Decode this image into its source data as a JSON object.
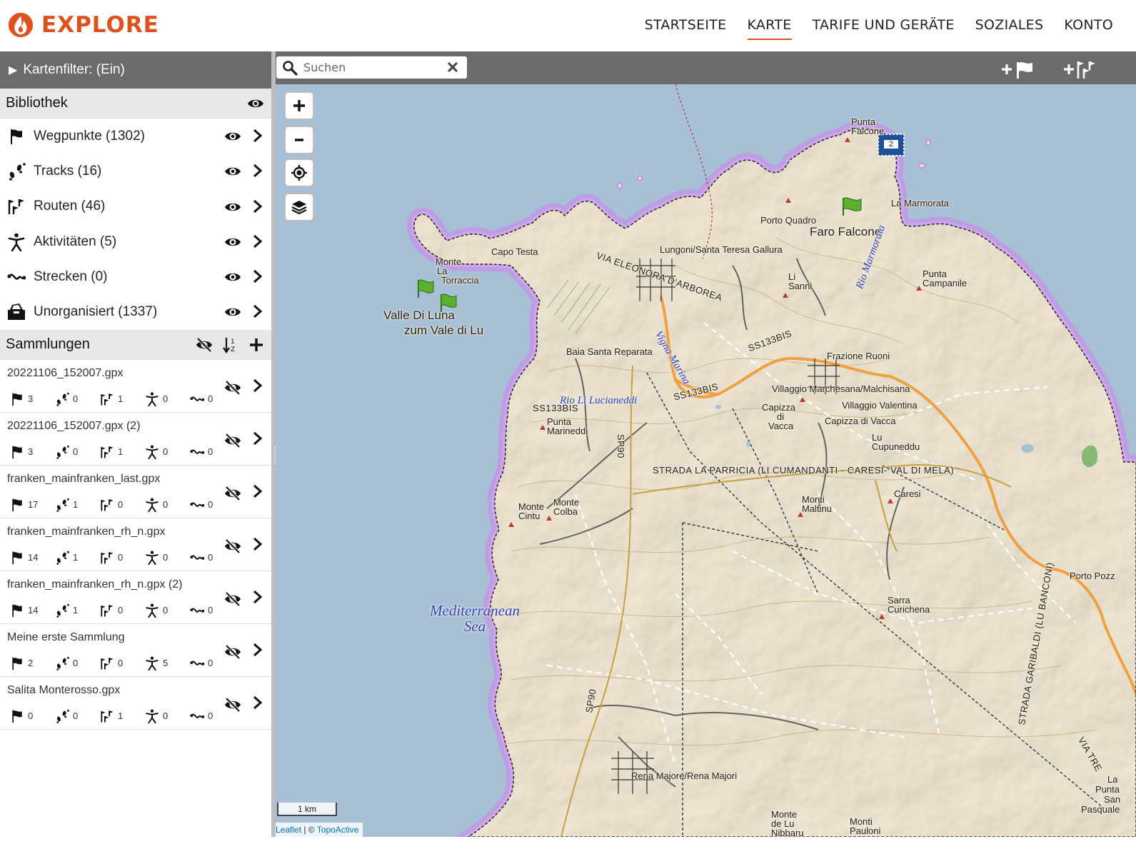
{
  "header": {
    "brand": "EXPLORE",
    "nav": [
      {
        "label": "STARTSEITE",
        "active": false
      },
      {
        "label": "KARTE",
        "active": true
      },
      {
        "label": "TARIFE UND GERÄTE",
        "active": false
      },
      {
        "label": "SOZIALES",
        "active": false
      },
      {
        "label": "KONTO",
        "active": false
      }
    ],
    "accent_color": "#e0501d"
  },
  "sidebar": {
    "filter_label": "Kartenfilter: (Ein)",
    "library": {
      "title": "Bibliothek",
      "items": [
        {
          "label": "Wegpunkte (1302)",
          "icon": "flag-icon"
        },
        {
          "label": "Tracks (16)",
          "icon": "footprints-icon"
        },
        {
          "label": "Routen (46)",
          "icon": "route-icon"
        },
        {
          "label": "Aktivitäten (5)",
          "icon": "activity-icon"
        },
        {
          "label": "Strecken (0)",
          "icon": "course-icon"
        },
        {
          "label": "Unorganisiert (1337)",
          "icon": "inbox-icon"
        }
      ]
    },
    "collections": {
      "title": "Sammlungen",
      "items": [
        {
          "name": "20221106_152007.gpx",
          "waypoints": "3",
          "tracks": "0",
          "routes": "1",
          "activities": "0",
          "courses": "0"
        },
        {
          "name": "20221106_152007.gpx (2)",
          "waypoints": "3",
          "tracks": "0",
          "routes": "1",
          "activities": "0",
          "courses": "0"
        },
        {
          "name": "franken_mainfranken_last.gpx",
          "waypoints": "17",
          "tracks": "1",
          "routes": "0",
          "activities": "0",
          "courses": "0"
        },
        {
          "name": "franken_mainfranken_rh_n.gpx",
          "waypoints": "14",
          "tracks": "1",
          "routes": "0",
          "activities": "0",
          "courses": "0"
        },
        {
          "name": "franken_mainfranken_rh_n.gpx (2)",
          "waypoints": "14",
          "tracks": "1",
          "routes": "0",
          "activities": "0",
          "courses": "0"
        },
        {
          "name": "Meine erste Sammlung",
          "waypoints": "2",
          "tracks": "0",
          "routes": "0",
          "activities": "5",
          "courses": "0"
        },
        {
          "name": "Salita Monterosso.gpx",
          "waypoints": "0",
          "tracks": "0",
          "routes": "1",
          "activities": "0",
          "courses": "0"
        }
      ]
    }
  },
  "map": {
    "search_placeholder": "Suchen",
    "scale_label": "1 km",
    "attribution_link": "Leaflet",
    "attribution_sep": " | © ",
    "attribution_source": "TopoActive",
    "cluster_count": "2",
    "colors": {
      "water": "#a7c0d6",
      "land": "#efe4c8",
      "boundary_glow": "#c88ee8",
      "major_road": "#f0a040",
      "minor_road": "#c8a040"
    },
    "labels": [
      {
        "text": "Punta",
        "cls": ""
      },
      {
        "text": "Falcone",
        "cls": ""
      },
      {
        "text": "La Marmorata",
        "cls": ""
      },
      {
        "text": "Porto Quadro",
        "cls": ""
      },
      {
        "text": "Faro Falcone",
        "cls": "big"
      },
      {
        "text": "Capo Testa",
        "cls": ""
      },
      {
        "text": "Lungoni/Santa Teresa Gallura",
        "cls": ""
      },
      {
        "text": "VIA ELEONORA D'ARBOREA",
        "cls": "road"
      },
      {
        "text": "Monte",
        "cls": ""
      },
      {
        "text": "La",
        "cls": ""
      },
      {
        "text": "Torraccia",
        "cls": ""
      },
      {
        "text": "Valle Di Luna",
        "cls": "big"
      },
      {
        "text": "zum Vale di Lu",
        "cls": "big"
      },
      {
        "text": "Li",
        "cls": ""
      },
      {
        "text": "Sanni",
        "cls": ""
      },
      {
        "text": "Punta",
        "cls": ""
      },
      {
        "text": "Campanile",
        "cls": ""
      },
      {
        "text": "Rio Marmorata",
        "cls": "water"
      },
      {
        "text": "SS133BIS",
        "cls": "road"
      },
      {
        "text": "Vigna Marina",
        "cls": "water"
      },
      {
        "text": "Baia Santa Reparata",
        "cls": ""
      },
      {
        "text": "SS133BIS",
        "cls": "road"
      },
      {
        "text": "Frazione Ruoni",
        "cls": ""
      },
      {
        "text": "Villaggio Marchesana/Malchisana",
        "cls": ""
      },
      {
        "text": "Villaggio Valentina",
        "cls": ""
      },
      {
        "text": "Capizza",
        "cls": ""
      },
      {
        "text": "di",
        "cls": ""
      },
      {
        "text": "Vacca",
        "cls": ""
      },
      {
        "text": "Capizza di Vacca",
        "cls": ""
      },
      {
        "text": "Rio Li Lucianeddi",
        "cls": "water"
      },
      {
        "text": "SS133BIS",
        "cls": "road"
      },
      {
        "text": "Lu",
        "cls": ""
      },
      {
        "text": "Cupuneddu",
        "cls": ""
      },
      {
        "text": "Punta",
        "cls": ""
      },
      {
        "text": "Marineddi",
        "cls": ""
      },
      {
        "text": "SP90",
        "cls": "road"
      },
      {
        "text": "STRADA LA PARRICIA (LI CUMANDANTI - CARESI- VAL DI MELA)",
        "cls": "road"
      },
      {
        "text": "Monti",
        "cls": ""
      },
      {
        "text": "Maltinu",
        "cls": ""
      },
      {
        "text": "Caresi",
        "cls": ""
      },
      {
        "text": "Monte",
        "cls": ""
      },
      {
        "text": "Cintu",
        "cls": ""
      },
      {
        "text": "Monte",
        "cls": ""
      },
      {
        "text": "Colba",
        "cls": ""
      },
      {
        "text": "Porto Pozz",
        "cls": ""
      },
      {
        "text": "Sarra",
        "cls": ""
      },
      {
        "text": "Curichena",
        "cls": ""
      },
      {
        "text": "STRADA GARIBALDI (LU BANCONI)",
        "cls": "road"
      },
      {
        "text": "SP90",
        "cls": "road"
      },
      {
        "text": "VIA TRE",
        "cls": "road"
      },
      {
        "text": "Rena Majore/Rena Majori",
        "cls": ""
      },
      {
        "text": "La",
        "cls": ""
      },
      {
        "text": "Punta",
        "cls": ""
      },
      {
        "text": "San",
        "cls": ""
      },
      {
        "text": "Pasquale",
        "cls": ""
      },
      {
        "text": "Monte",
        "cls": ""
      },
      {
        "text": "de Lu",
        "cls": ""
      },
      {
        "text": "Nibbaru",
        "cls": ""
      },
      {
        "text": "Monti",
        "cls": ""
      },
      {
        "text": "Pauloni",
        "cls": ""
      }
    ],
    "sea_label": [
      "Mediterranean",
      "Sea"
    ]
  }
}
